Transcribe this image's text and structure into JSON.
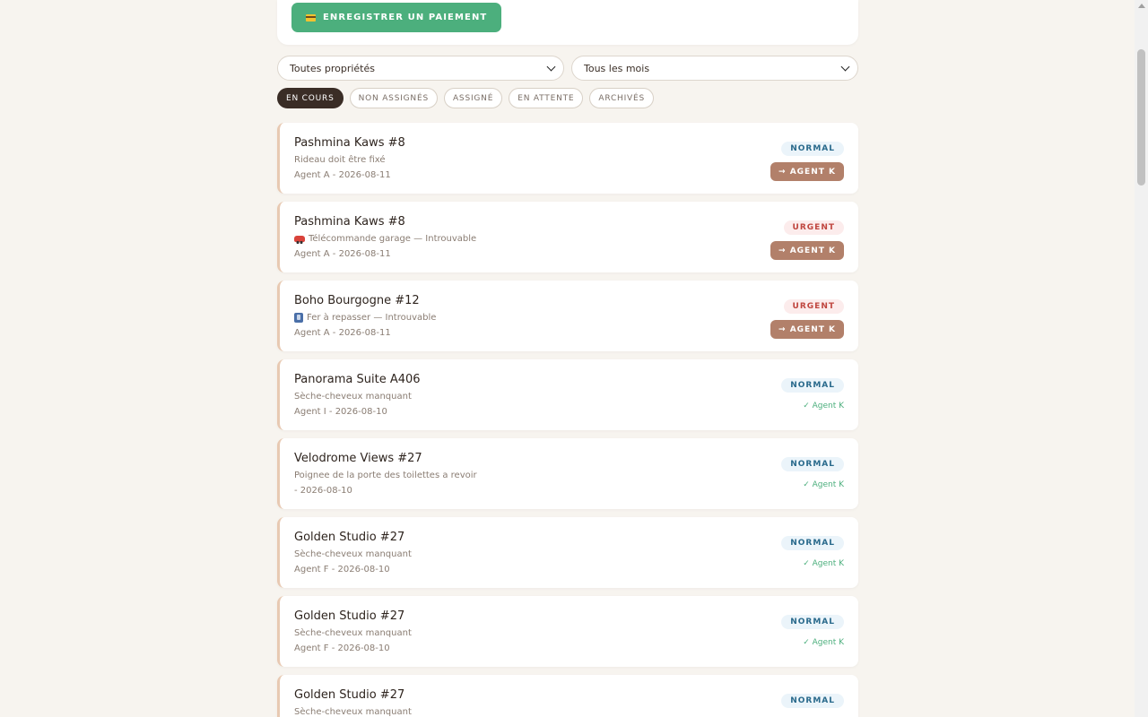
{
  "actions": {
    "payment_button_label": "ENREGISTRER UN PAIEMENT",
    "payment_icon": "credit-card-icon"
  },
  "filters": {
    "property_select": {
      "selected": "Toutes propriétés"
    },
    "month_select": {
      "selected": "Tous les mois"
    }
  },
  "tabs": [
    {
      "label": "EN COURS",
      "active": true
    },
    {
      "label": "NON ASSIGNÉS",
      "active": false
    },
    {
      "label": "ASSIGNÉ",
      "active": false
    },
    {
      "label": "EN ATTENTE",
      "active": false
    },
    {
      "label": "ARCHIVÉS",
      "active": false
    }
  ],
  "tickets": [
    {
      "title": "Pashmina Kaws #8",
      "description": "Rideau doit être fixé",
      "icon": "",
      "meta": "Agent A - 2026-08-11",
      "priority": "NORMAL",
      "priority_level": "normal",
      "action_label": "→ AGENT K",
      "assigned_label": ""
    },
    {
      "title": "Pashmina Kaws #8",
      "description": "Télécommande garage — Introuvable",
      "icon": "car-icon",
      "meta": "Agent A - 2026-08-11",
      "priority": "URGENT",
      "priority_level": "urgent",
      "action_label": "→ AGENT K",
      "assigned_label": ""
    },
    {
      "title": "Boho Bourgogne #12",
      "description": "Fer à repasser — Introuvable",
      "icon": "iron-icon",
      "meta": "Agent A - 2026-08-11",
      "priority": "URGENT",
      "priority_level": "urgent",
      "action_label": "→ AGENT K",
      "assigned_label": ""
    },
    {
      "title": "Panorama Suite A406",
      "description": "Sèche-cheveux manquant",
      "icon": "",
      "meta": "Agent I - 2026-08-10",
      "priority": "NORMAL",
      "priority_level": "normal",
      "action_label": "",
      "assigned_label": "✓ Agent K"
    },
    {
      "title": "Velodrome Views #27",
      "description": "Poignee de la porte des toilettes a revoir",
      "icon": "",
      "meta": "- 2026-08-10",
      "priority": "NORMAL",
      "priority_level": "normal",
      "action_label": "",
      "assigned_label": "✓ Agent K"
    },
    {
      "title": "Golden Studio #27",
      "description": "Sèche-cheveux manquant",
      "icon": "",
      "meta": "Agent F - 2026-08-10",
      "priority": "NORMAL",
      "priority_level": "normal",
      "action_label": "",
      "assigned_label": "✓ Agent K"
    },
    {
      "title": "Golden Studio #27",
      "description": "Sèche-cheveux manquant",
      "icon": "",
      "meta": "Agent F - 2026-08-10",
      "priority": "NORMAL",
      "priority_level": "normal",
      "action_label": "",
      "assigned_label": "✓ Agent K"
    },
    {
      "title": "Golden Studio #27",
      "description": "Sèche-cheveux manquant",
      "icon": "",
      "meta": "",
      "priority": "NORMAL",
      "priority_level": "normal",
      "action_label": "",
      "assigned_label": ""
    }
  ],
  "colors": {
    "background": "#f7f4ef",
    "accent_green": "#4caf7d",
    "assign_brown": "#b2806a",
    "active_tab": "#3a2d26",
    "urgent_text": "#c0463f",
    "normal_text": "#2a6a8c"
  }
}
